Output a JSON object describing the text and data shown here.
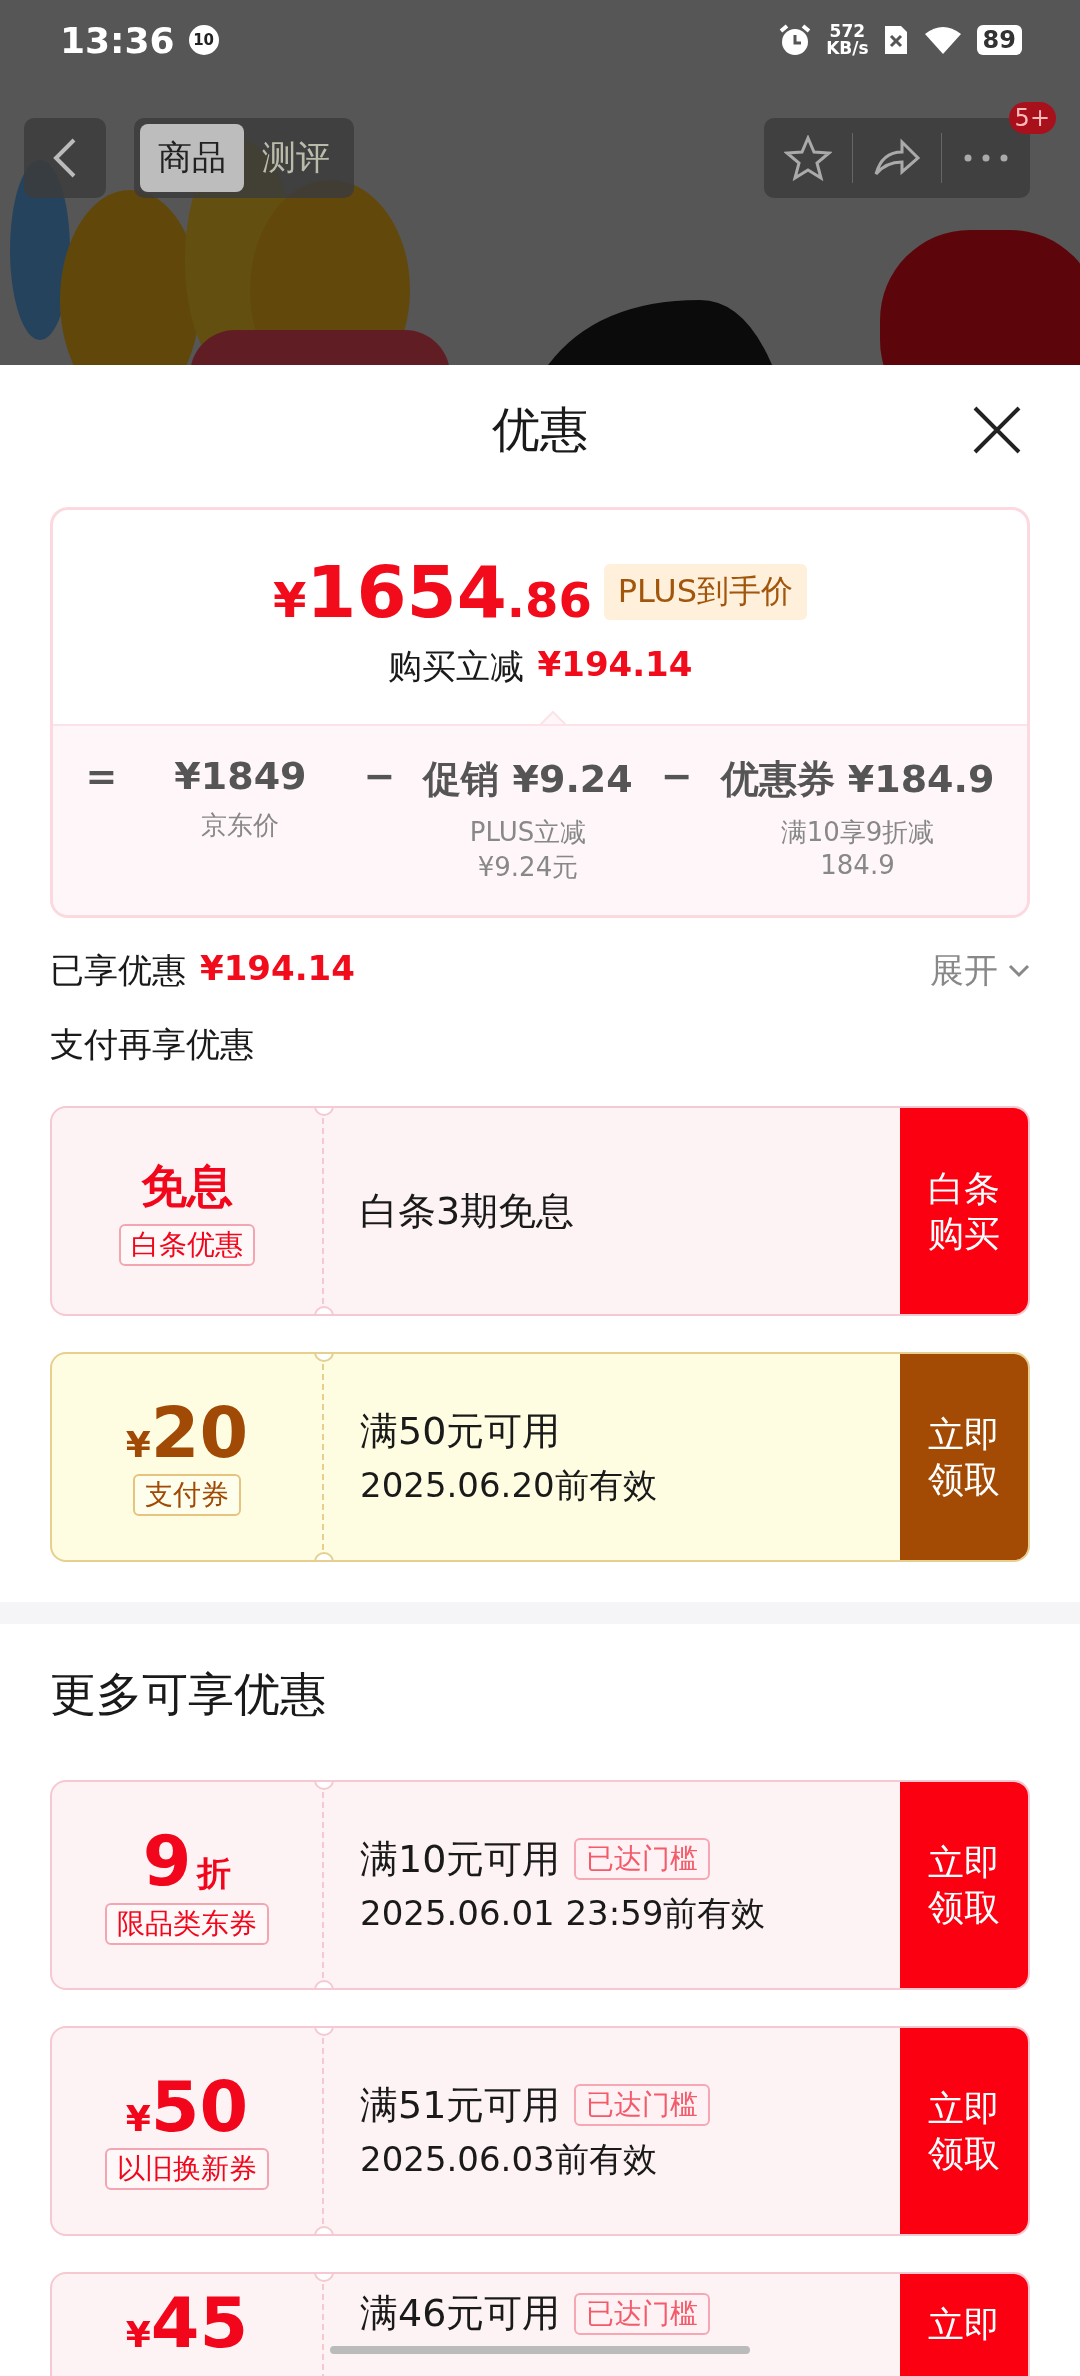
{
  "status_bar": {
    "time": "13:36",
    "notification_count": "10",
    "net_speed": "572",
    "net_unit": "KB/s",
    "battery": "89"
  },
  "nav": {
    "tabs": [
      {
        "label": "商品",
        "selected": true
      },
      {
        "label": "测评",
        "selected": false
      }
    ],
    "badge": "5+"
  },
  "sheet": {
    "title": "优惠"
  },
  "price_card": {
    "currency": "¥",
    "amount": "1654",
    "decimal": ".86",
    "tag": "PLUS到手价",
    "saving_label": "购买立减",
    "saving_amount": "¥194.14",
    "breakdown": [
      {
        "operator": "=",
        "value": "¥1849",
        "note": "京东价"
      },
      {
        "operator": "−",
        "label": "促销",
        "value": "¥9.24",
        "note": "PLUS立减¥9.24元"
      },
      {
        "operator": "−",
        "label": "优惠券",
        "value": "¥184.9",
        "note": "满10享9折减184.9"
      }
    ]
  },
  "enjoyed": {
    "label": "已享优惠",
    "amount": "¥194.14",
    "expand": "展开"
  },
  "pay_section": {
    "title": "支付再享优惠",
    "coupons": [
      {
        "kind": "standard",
        "value": "免息",
        "tag": "白条优惠",
        "title": "白条3期免息",
        "button": "白条购买"
      },
      {
        "kind": "payment",
        "currency": "¥",
        "value": "20",
        "tag": "支付券",
        "title": "满50元可用",
        "validity": "2025.06.20前有效",
        "button": "立即领取"
      }
    ]
  },
  "more_section": {
    "title": "更多可享优惠",
    "coupons": [
      {
        "kind": "standard",
        "value": "9",
        "unit": "折",
        "tag": "限品类东券",
        "title": "满10元可用",
        "badge": "已达门槛",
        "validity": "2025.06.01 23:59前有效",
        "button": "立即领取"
      },
      {
        "kind": "standard",
        "currency": "¥",
        "value": "50",
        "tag": "以旧换新券",
        "title": "满51元可用",
        "badge": "已达门槛",
        "validity": "2025.06.03前有效",
        "button": "立即领取"
      },
      {
        "kind": "standard",
        "currency": "¥",
        "value": "45",
        "title": "满46元可用",
        "badge": "已达门槛",
        "button": "立即"
      }
    ]
  }
}
